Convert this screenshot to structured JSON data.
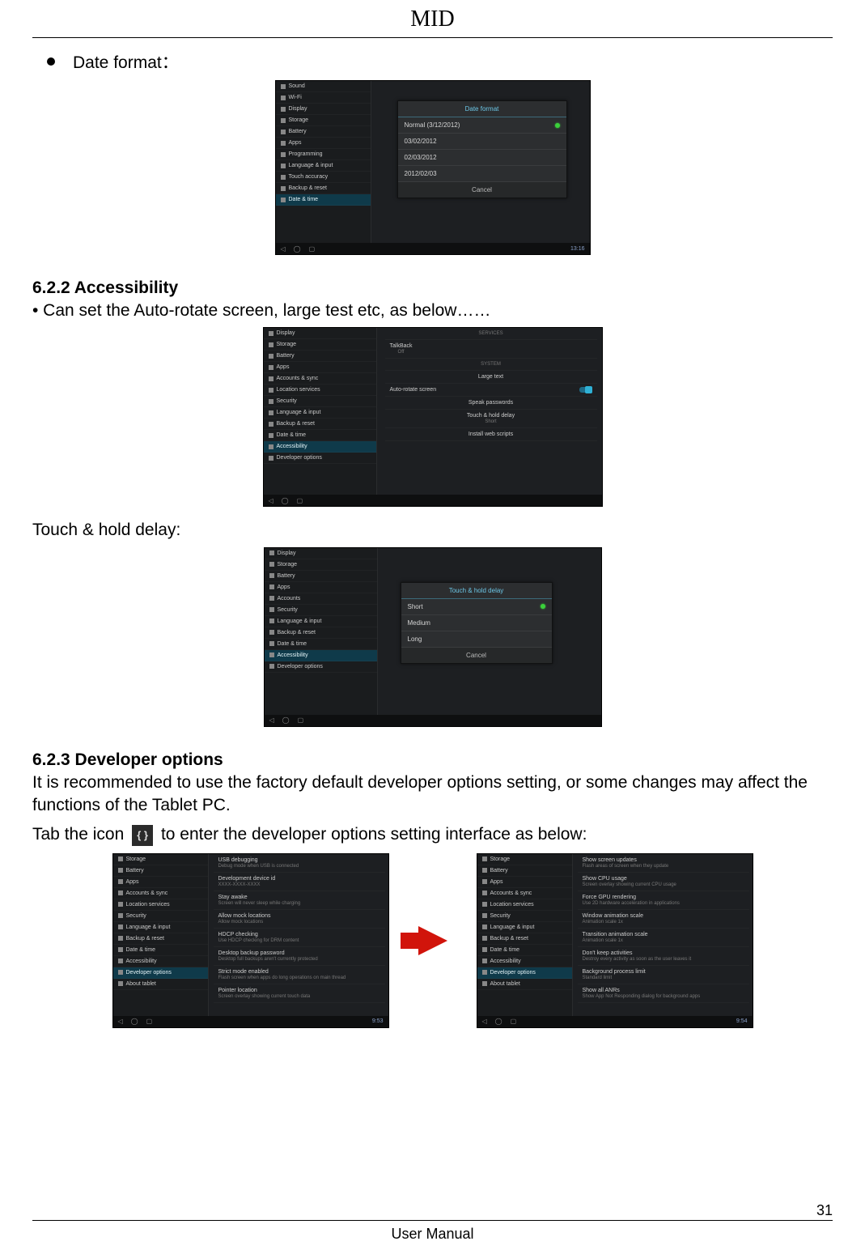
{
  "header": {
    "title": "MID"
  },
  "bullet1": {
    "label": "Date format："
  },
  "screenshot_date_format": {
    "sidebar": [
      "Sound",
      "Wi-Fi",
      "Display",
      "Storage",
      "Battery",
      "Apps",
      "Programming",
      "Language & input",
      "Touch accuracy",
      "Backup & reset",
      "Date & time"
    ],
    "dialog": {
      "title": "Date format",
      "options": [
        "Normal (3/12/2012)",
        "03/02/2012",
        "02/03/2012",
        "2012/02/03"
      ],
      "selected_index": 0,
      "cancel": "Cancel"
    },
    "status_time": "13:16"
  },
  "section_622": {
    "title": "6.2.2 Accessibility",
    "line1": "• Can set the Auto-rotate screen, large test etc, as below……"
  },
  "screenshot_accessibility": {
    "subheader_services": "SERVICES",
    "service_item": "TalkBack",
    "service_sub": "Off",
    "subheader_system": "SYSTEM",
    "items": [
      "Large text",
      "Auto-rotate screen",
      "Speak passwords",
      "Touch & hold delay",
      "Install web scripts"
    ],
    "touch_sub": "Short",
    "sidebar": [
      "Display",
      "Storage",
      "Battery",
      "Apps",
      "Accounts & sync",
      "Location services",
      "Security",
      "Language & input",
      "Backup & reset",
      "Date & time",
      "Accessibility",
      "Developer options"
    ],
    "highlight_index": 10
  },
  "touch_hold_label": "Touch & hold delay:",
  "screenshot_touch_hold": {
    "sidebar": [
      "Display",
      "Storage",
      "Battery",
      "Apps",
      "Accounts",
      "Security",
      "Language & input",
      "Backup & reset",
      "Date & time",
      "Accessibility",
      "Developer options"
    ],
    "dialog": {
      "title": "Touch & hold delay",
      "options": [
        "Short",
        "Medium",
        "Long"
      ],
      "selected_index": 0,
      "cancel": "Cancel"
    }
  },
  "section_623": {
    "title": "6.2.3 Developer options",
    "line1": "It is recommended to use the factory default developer options setting, or some changes may affect the functions of the Tablet PC.",
    "line2a": "Tab the icon ",
    "icon_label": "{ }",
    "line2b": " to enter the developer options setting interface as below:"
  },
  "screenshot_dev_left": {
    "sidebar": [
      "Storage",
      "Battery",
      "Apps",
      "Accounts & sync",
      "Location services",
      "Security",
      "Language & input",
      "Backup & reset",
      "Date & time",
      "Accessibility",
      "Developer options",
      "About tablet"
    ],
    "highlight_index": 10,
    "right_items": [
      {
        "t": "USB debugging",
        "s": "Debug mode when USB is connected"
      },
      {
        "t": "Development device id",
        "s": "XXXX-XXXX-XXXX"
      },
      {
        "t": "Stay awake",
        "s": "Screen will never sleep while charging"
      },
      {
        "t": "Allow mock locations",
        "s": "Allow mock locations"
      },
      {
        "t": "HDCP checking",
        "s": "Use HDCP checking for DRM content"
      },
      {
        "t": "Desktop backup password",
        "s": "Desktop full backups aren't currently protected"
      },
      {
        "t": "Strict mode enabled",
        "s": "Flash screen when apps do long operations on main thread"
      },
      {
        "t": "Pointer location",
        "s": "Screen overlay showing current touch data"
      }
    ],
    "status_time": "9:53"
  },
  "screenshot_dev_right": {
    "sidebar": [
      "Storage",
      "Battery",
      "Apps",
      "Accounts & sync",
      "Location services",
      "Security",
      "Language & input",
      "Backup & reset",
      "Date & time",
      "Accessibility",
      "Developer options",
      "About tablet"
    ],
    "highlight_index": 10,
    "right_items": [
      {
        "t": "Show screen updates",
        "s": "Flash areas of screen when they update"
      },
      {
        "t": "Show CPU usage",
        "s": "Screen overlay showing current CPU usage"
      },
      {
        "t": "Force GPU rendering",
        "s": "Use 2D hardware acceleration in applications"
      },
      {
        "t": "Window animation scale",
        "s": "Animation scale 1x"
      },
      {
        "t": "Transition animation scale",
        "s": "Animation scale 1x"
      },
      {
        "t": "Don't keep activities",
        "s": "Destroy every activity as soon as the user leaves it"
      },
      {
        "t": "Background process limit",
        "s": "Standard limit"
      },
      {
        "t": "Show all ANRs",
        "s": "Show App Not Responding dialog for background apps"
      }
    ],
    "status_time": "9:54"
  },
  "footer": {
    "label": "User Manual",
    "page": "31"
  }
}
